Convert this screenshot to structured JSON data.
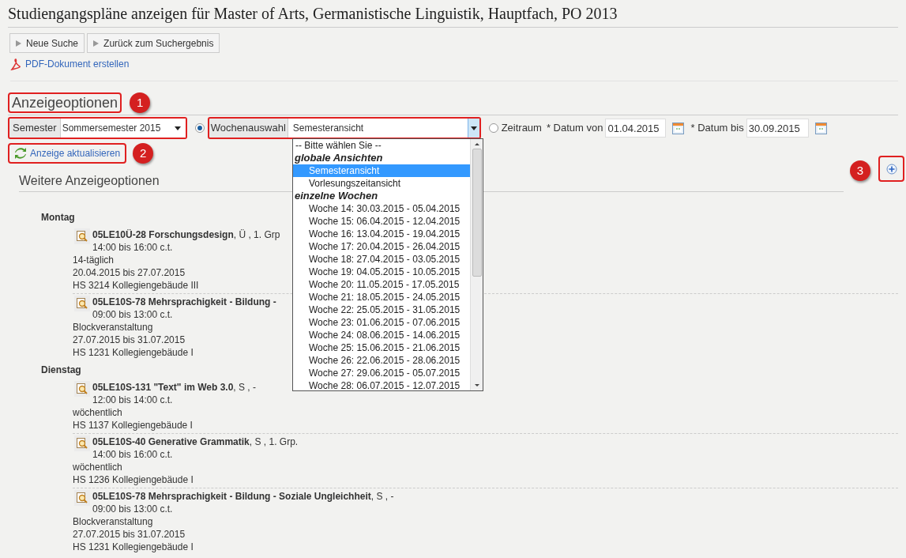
{
  "page_title": "Studiengangspläne anzeigen für Master of Arts, Germanistische Linguistik, Hauptfach, PO 2013",
  "nav_buttons": [
    "Neue Suche",
    "Zurück zum Suchergebnis"
  ],
  "pdf_link": "PDF-Dokument erstellen",
  "options": {
    "heading": "Anzeigeoptionen",
    "badge": "1",
    "semester": {
      "label": "Semester",
      "value": "Sommersemester 2015"
    },
    "week_mode": {
      "selected": true,
      "label": "Wochenauswahl",
      "value": "Semesteransicht"
    },
    "range_mode": {
      "selected": false,
      "label": "Zeitraum",
      "from_label": "* Datum von",
      "from": "01.04.2015",
      "to_label": "* Datum bis",
      "to": "30.09.2015"
    },
    "refresh": "Anzeige aktualisieren",
    "refresh_badge": "2"
  },
  "more_options": {
    "heading": "Weitere Anzeigeoptionen",
    "badge": "3"
  },
  "days": [
    {
      "day": "Montag",
      "events": [
        {
          "title": "**05LE10Ü-28 Forschungsdesign**, Ü , 1. Grp",
          "time": "14:00 bis 16:00 c.t.",
          "details": [
            "14-täglich",
            "20.04.2015 bis 27.07.2015",
            "HS 3214 Kollegiengebäude III"
          ]
        },
        {
          "title": "**05LE10S-78 Mehrsprachigkeit - Bildung -**",
          "time": "09:00 bis 13:00 c.t.",
          "details": [
            "Blockveranstaltung",
            "27.07.2015 bis 31.07.2015",
            "HS 1231 Kollegiengebäude I"
          ]
        }
      ]
    },
    {
      "day": "Dienstag",
      "events": [
        {
          "title": "**05LE10S-131 \"Text\" im Web 3.0**, S , -",
          "time": "12:00 bis 14:00 c.t.",
          "details": [
            "wöchentlich",
            "HS 1137 Kollegiengebäude I"
          ]
        },
        {
          "title": "**05LE10S-40 Generative Grammatik**, S , 1. Grp.",
          "time": "14:00 bis 16:00 c.t.",
          "details": [
            "wöchentlich",
            "HS 1236 Kollegiengebäude I"
          ]
        },
        {
          "title": "**05LE10S-78 Mehrsprachigkeit - Bildung - Soziale Ungleichheit**, S , -",
          "time": "09:00 bis 13:00 c.t.",
          "details": [
            "Blockveranstaltung",
            "27.07.2015 bis 31.07.2015",
            "HS 1231 Kollegiengebäude I"
          ]
        }
      ]
    }
  ],
  "week_dropdown": [
    {
      "kind": "option",
      "label": "-- Bitte wählen Sie --",
      "selected": false
    },
    {
      "kind": "group",
      "label": "globale Ansichten"
    },
    {
      "kind": "option",
      "label": "Semesteransicht",
      "selected": true
    },
    {
      "kind": "option",
      "label": "Vorlesungszeitansicht",
      "selected": false
    },
    {
      "kind": "group",
      "label": "einzelne Wochen"
    },
    {
      "kind": "option",
      "label": "Woche 14: 30.03.2015 - 05.04.2015",
      "selected": false
    },
    {
      "kind": "option",
      "label": "Woche 15: 06.04.2015 - 12.04.2015",
      "selected": false
    },
    {
      "kind": "option",
      "label": "Woche 16: 13.04.2015 - 19.04.2015",
      "selected": false
    },
    {
      "kind": "option",
      "label": "Woche 17: 20.04.2015 - 26.04.2015",
      "selected": false
    },
    {
      "kind": "option",
      "label": "Woche 18: 27.04.2015 - 03.05.2015",
      "selected": false
    },
    {
      "kind": "option",
      "label": "Woche 19: 04.05.2015 - 10.05.2015",
      "selected": false
    },
    {
      "kind": "option",
      "label": "Woche 20: 11.05.2015 - 17.05.2015",
      "selected": false
    },
    {
      "kind": "option",
      "label": "Woche 21: 18.05.2015 - 24.05.2015",
      "selected": false
    },
    {
      "kind": "option",
      "label": "Woche 22: 25.05.2015 - 31.05.2015",
      "selected": false
    },
    {
      "kind": "option",
      "label": "Woche 23: 01.06.2015 - 07.06.2015",
      "selected": false
    },
    {
      "kind": "option",
      "label": "Woche 24: 08.06.2015 - 14.06.2015",
      "selected": false
    },
    {
      "kind": "option",
      "label": "Woche 25: 15.06.2015 - 21.06.2015",
      "selected": false
    },
    {
      "kind": "option",
      "label": "Woche 26: 22.06.2015 - 28.06.2015",
      "selected": false
    },
    {
      "kind": "option",
      "label": "Woche 27: 29.06.2015 - 05.07.2015",
      "selected": false
    },
    {
      "kind": "option",
      "label": "Woche 28: 06.07.2015 - 12.07.2015",
      "selected": false
    }
  ]
}
